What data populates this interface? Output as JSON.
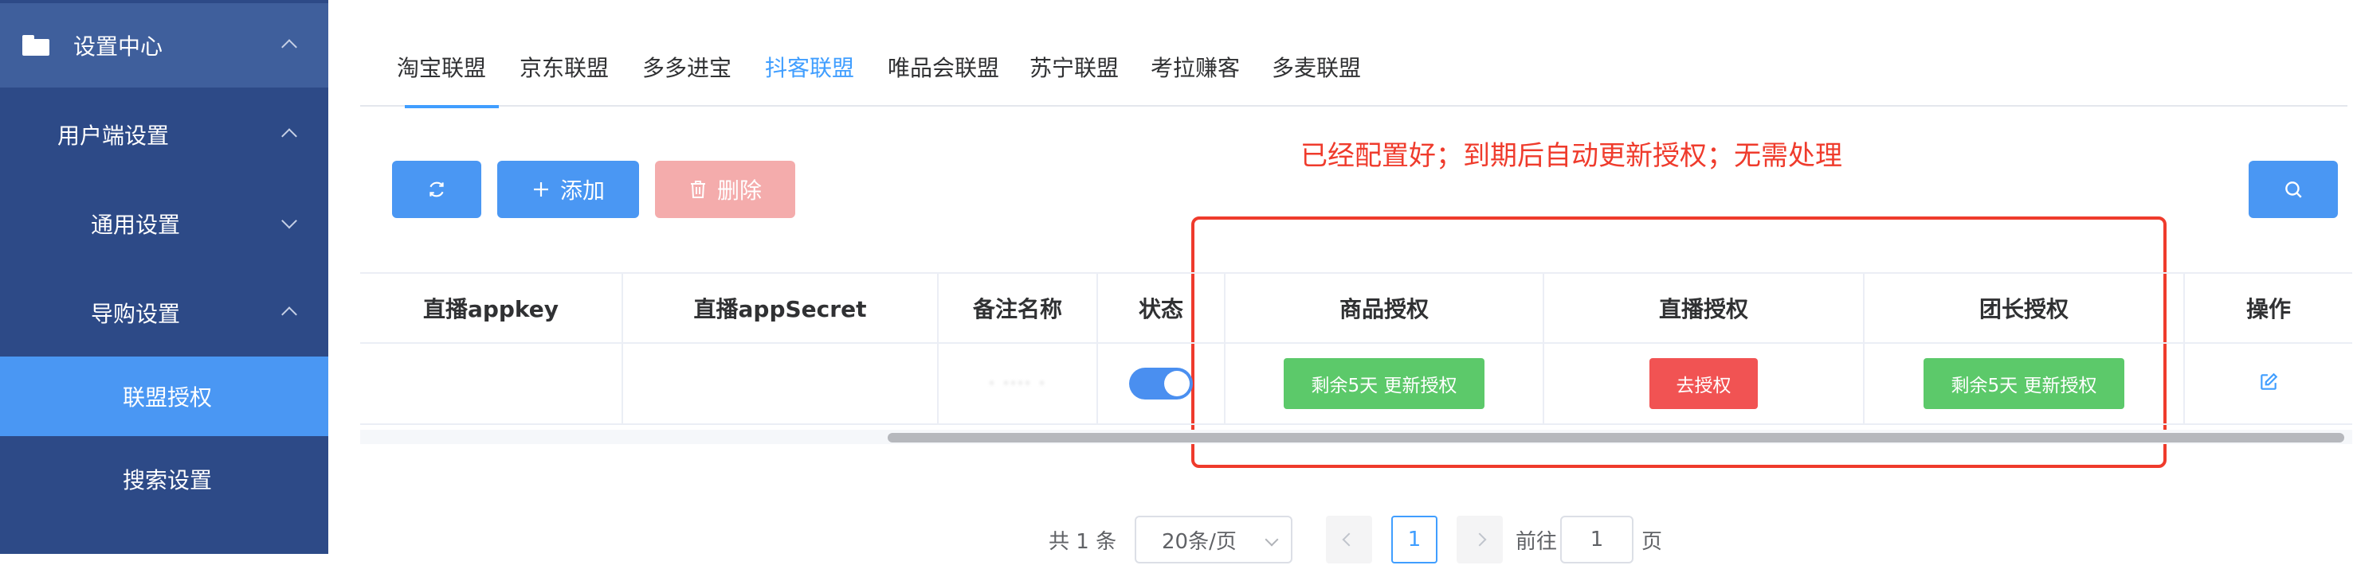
{
  "sidebar": {
    "items": [
      {
        "label": "设置中心"
      },
      {
        "label": "用户端设置"
      },
      {
        "label": "通用设置"
      },
      {
        "label": "导购设置"
      },
      {
        "label": "联盟授权"
      },
      {
        "label": "搜索设置"
      }
    ]
  },
  "tabs": [
    "淘宝联盟",
    "京东联盟",
    "多多进宝",
    "抖客联盟",
    "唯品会联盟",
    "苏宁联盟",
    "考拉赚客",
    "多麦联盟"
  ],
  "active_tab": "抖客联盟",
  "toolbar": {
    "add_label": "添加",
    "delete_label": "删除"
  },
  "annotation": "已经配置好；到期后自动更新授权；无需处理",
  "table": {
    "headers": [
      "直播appkey",
      "直播appSecret",
      "备注名称",
      "状态",
      "商品授权",
      "直播授权",
      "团长授权",
      "操作"
    ],
    "row": {
      "appkey": "",
      "appsecret": "",
      "remark_blurred": "· ···· ·",
      "status_on": true,
      "product_auth": "剩余5天 更新授权",
      "live_auth": "去授权",
      "leader_auth": "剩余5天 更新授权"
    }
  },
  "pagination": {
    "total": "共 1 条",
    "page_size": "20条/页",
    "current": "1",
    "goto_label": "前往",
    "goto_value": "1",
    "page_unit": "页"
  },
  "colors": {
    "sidebar_bg": "#2d4a87",
    "sidebar_active": "#4a97f3",
    "primary": "#4a97f3",
    "danger_disabled": "#f4acac",
    "success": "#5cc96a",
    "danger": "#f15353",
    "annotation": "#ef3b2c"
  }
}
